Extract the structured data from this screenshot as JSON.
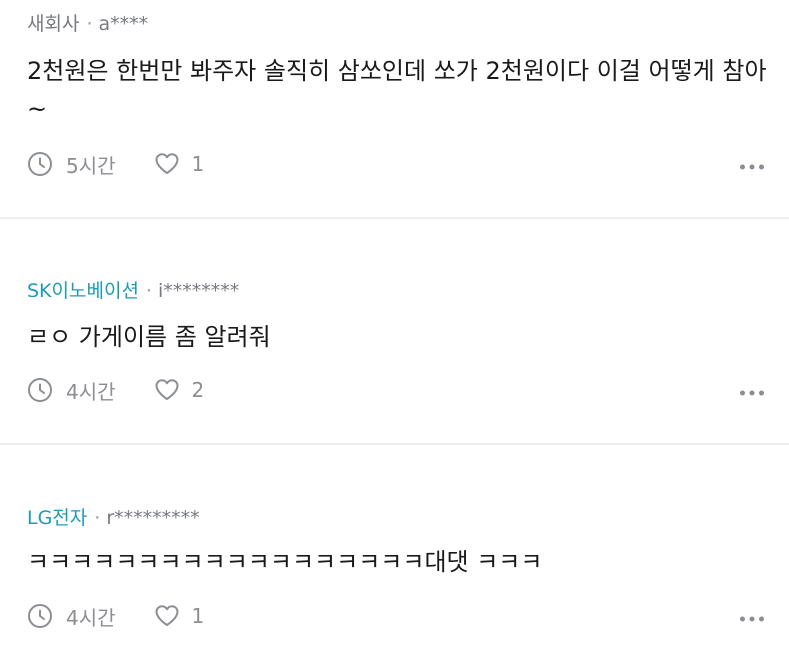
{
  "comments": [
    {
      "company": "새회사",
      "separator": "·",
      "user": "a****",
      "text": "2천원은 한번만 봐주자 솔직히 삼쏘인데 쏘가 2천원이다 이걸 어떻게 참아~",
      "time": "5시간",
      "likes": "1"
    },
    {
      "company": "SK이노베이션",
      "separator": "·",
      "user": "i********",
      "text": "ㄹㅇ 가게이름 좀 알려줘",
      "time": "4시간",
      "likes": "2"
    },
    {
      "company": "LG전자",
      "separator": "·",
      "user": "r*********",
      "text": "ㅋㅋㅋㅋㅋㅋㅋㅋㅋㅋㅋㅋㅋㅋㅋㅋㅋㅋ대댓 ㅋㅋㅋ",
      "time": "4시간",
      "likes": "1"
    }
  ],
  "icons": {
    "time": "clock-icon",
    "like": "heart-icon",
    "more": "more-dots-icon"
  },
  "colors": {
    "company_link": "#1e9bb5",
    "meta_text": "#777a80",
    "body_text": "#1a1a1a",
    "icon_gray": "#8b8e93",
    "divider": "#eeeff1"
  }
}
